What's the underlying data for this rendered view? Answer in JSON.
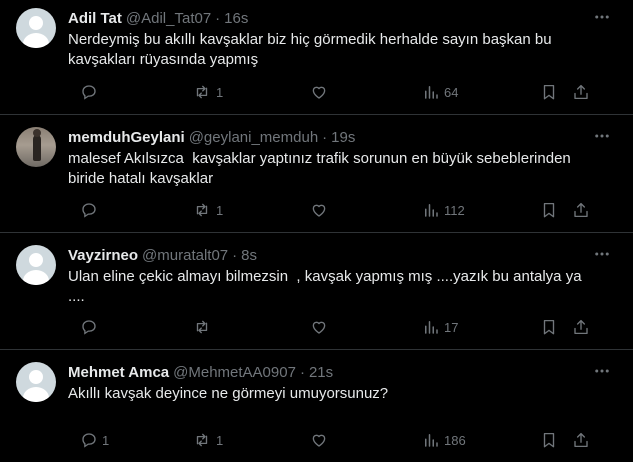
{
  "tweets": [
    {
      "name": "Adil Tat",
      "handle": "@Adil_Tat07",
      "separator": "·",
      "time": "16s",
      "text": "Nerdeymiş bu akıllı kavşaklar biz hiç görmedik herhalde sayın başkan bu kavşakları rüyasında yapmış",
      "replies": "",
      "retweets": "1",
      "likes": "",
      "views": "64",
      "avatar": "default-avatar"
    },
    {
      "name": "memduhGeylani",
      "handle": "@geylani_memduh",
      "separator": "·",
      "time": "19s",
      "text": "malesef Akılsızca  kavşaklar yaptınız trafik sorunun en büyük sebeblerinden biride hatalı kavşaklar",
      "replies": "",
      "retweets": "1",
      "likes": "",
      "views": "112",
      "avatar": "photo-avatar"
    },
    {
      "name": "Vayzirneo",
      "handle": "@muratalt07",
      "separator": "·",
      "time": "8s",
      "text": "Ulan eline çekic almayı bilmezsin  , kavşak yapmış mış ....yazık bu antalya ya\n....",
      "replies": "",
      "retweets": "",
      "likes": "",
      "views": "17",
      "avatar": "default-avatar"
    },
    {
      "name": "Mehmet Amca",
      "handle": "@MehmetAA0907",
      "separator": "·",
      "time": "21s",
      "text": "Akıllı kavşak deyince ne görmeyi umuyorsunuz?",
      "replies": "1",
      "retweets": "1",
      "likes": "",
      "views": "186",
      "avatar": "default-avatar"
    }
  ],
  "colors": {
    "background": "#000000",
    "text": "#e7e9ea",
    "muted": "#71767b",
    "divider": "#2f3336"
  },
  "icons": [
    "more-icon",
    "reply-icon",
    "retweet-icon",
    "like-icon",
    "views-icon",
    "bookmark-icon",
    "share-icon"
  ]
}
